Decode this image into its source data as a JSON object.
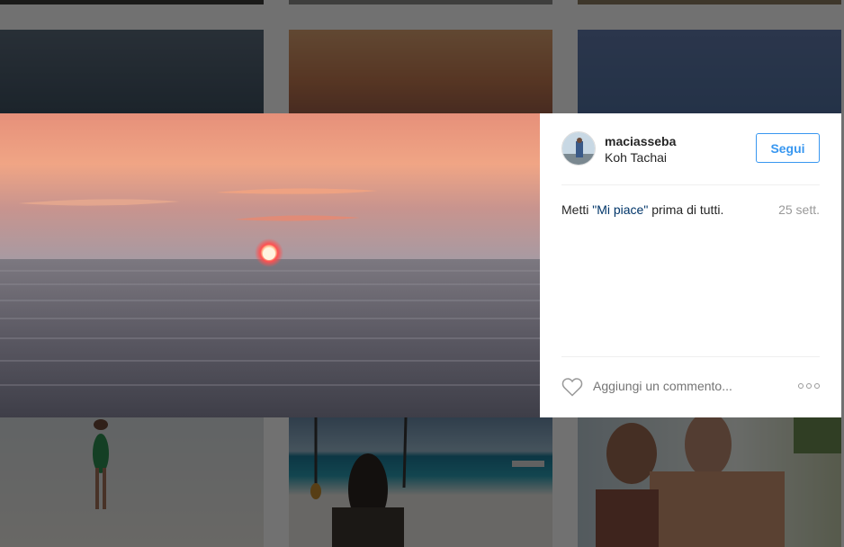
{
  "post": {
    "username": "maciasseba",
    "location": "Koh Tachai",
    "follow_label": "Segui",
    "likes_prefix": "Metti ",
    "likes_link": "\"Mi piace\"",
    "likes_suffix": " prima di tutti.",
    "date": "25 sett.",
    "comment_placeholder": "Aggiungi un commento...",
    "more_icon": "ellipsis-icon",
    "like_icon": "heart-icon"
  },
  "colors": {
    "accent": "#3897f0",
    "link": "#003569",
    "muted": "#999999"
  }
}
